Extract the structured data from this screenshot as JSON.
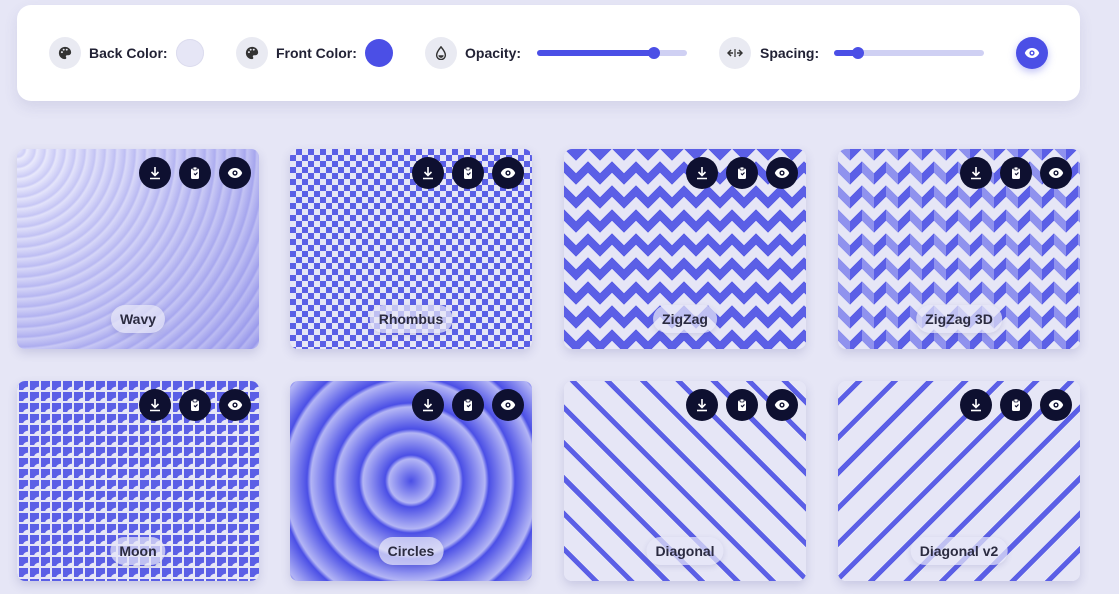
{
  "toolbar": {
    "back_color": {
      "label": "Back Color:",
      "value": "#e6e6f6",
      "icon": "palette-icon"
    },
    "front_color": {
      "label": "Front Color:",
      "value": "#4b4fe6",
      "icon": "palette-icon"
    },
    "opacity": {
      "label": "Opacity:",
      "value": 0.78,
      "icon": "droplet-icon"
    },
    "spacing": {
      "label": "Spacing:",
      "value": 0.16,
      "icon": "arrows-horizontal-icon"
    },
    "preview_icon": "eye-icon"
  },
  "colors": {
    "accent": "#4b4fe6",
    "background": "#e6e6f6",
    "action_button": "#0e1030"
  },
  "card_actions": [
    "download-icon",
    "copy-icon",
    "eye-icon"
  ],
  "patterns": [
    {
      "name": "Wavy"
    },
    {
      "name": "Rhombus"
    },
    {
      "name": "ZigZag"
    },
    {
      "name": "ZigZag 3D"
    },
    {
      "name": "Moon"
    },
    {
      "name": "Circles"
    },
    {
      "name": "Diagonal"
    },
    {
      "name": "Diagonal v2"
    }
  ]
}
